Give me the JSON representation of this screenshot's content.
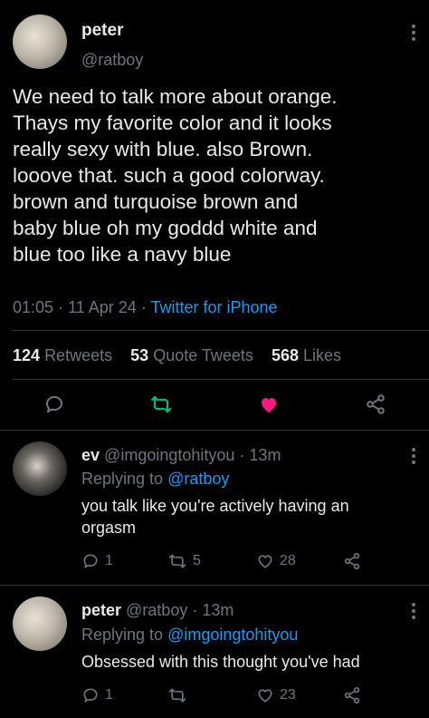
{
  "main_tweet": {
    "author_name": "peter",
    "handle": "@ratboy",
    "text_lines": [
      "We need to talk more about orange.",
      "Thays my favorite color and it looks",
      "really sexy with blue. also Brown.",
      "looove that. such a good colorway.",
      "brown and turquoise brown and",
      "baby blue oh my goddd white and",
      "blue too like a navy blue"
    ],
    "time": "01:05",
    "date": "11 Apr 24",
    "source": "Twitter for iPhone",
    "stats": {
      "retweets_count": "124",
      "retweets_label": "Retweets",
      "quotes_count": "53",
      "quotes_label": "Quote Tweets",
      "likes_count": "568",
      "likes_label": "Likes"
    }
  },
  "replies": [
    {
      "author_name": "ev",
      "handle": "@imgoingtohityou",
      "time_ago": "13m",
      "replying_to_label": "Replying to",
      "replying_to": "@ratboy",
      "text_lines": [
        "you talk like you're actively having an",
        "orgasm"
      ],
      "reply_count": "1",
      "retweet_count": "5",
      "like_count": "28"
    },
    {
      "author_name": "peter",
      "handle": "@ratboy",
      "time_ago": "13m",
      "replying_to_label": "Replying to",
      "replying_to": "@imgoingtohityou",
      "text_lines": [
        "Obsessed with this thought you've had"
      ],
      "reply_count": "1",
      "retweet_count": "",
      "like_count": "23"
    }
  ],
  "colors": {
    "background": "#000000",
    "accent_blue": "#1d9bf0",
    "retweet_green": "#00ba7c",
    "like_pink": "#f91880",
    "muted": "#6e767d"
  }
}
